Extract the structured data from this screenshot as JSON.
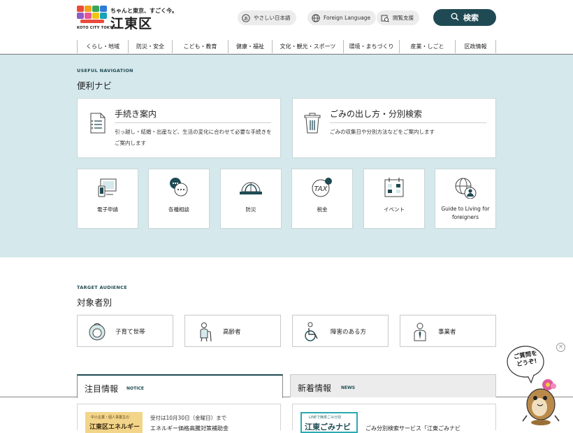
{
  "header": {
    "logo_tagline": "KOTO CITY TOKYO",
    "logo_sub": "ちゃんと東京、すごく今。",
    "logo_main": "江東区",
    "easy_japanese": "やさしい日本語",
    "foreign_language": "Foreign Language",
    "reading_support": "閲覧支援",
    "search": "検索",
    "nav": [
      "くらし・地域",
      "防災・安全",
      "こども・教育",
      "健康・福祉",
      "文化・観光・スポーツ",
      "環境・まちづくり",
      "産業・しごと",
      "区政情報"
    ]
  },
  "useful": {
    "en": "USEFUL NAVIGATION",
    "title": "便利ナビ",
    "big_cards": [
      {
        "title": "手続き案内",
        "desc": "引っ越し・結婚・出産など、生活の変化に合わせて必要な手続きをご案内します"
      },
      {
        "title": "ごみの出し方・分別検索",
        "desc": "ごみの収集日や分別方法などをご案内します"
      }
    ],
    "small_cards": [
      {
        "label": "電子申請",
        "icon": "device-icon"
      },
      {
        "label": "各種相談",
        "icon": "consult-icon"
      },
      {
        "label": "防災",
        "icon": "helmet-icon"
      },
      {
        "label": "税金",
        "icon": "tax-icon"
      },
      {
        "label": "イベント",
        "icon": "calendar-icon"
      },
      {
        "label": "Guide to Living for foreigners",
        "icon": "globe-person-icon"
      }
    ]
  },
  "audience": {
    "en": "TARGET AUDIENCE",
    "title": "対象者別",
    "items": [
      {
        "label": "子育て世帯",
        "icon": "baby-icon"
      },
      {
        "label": "高齢者",
        "icon": "elderly-icon"
      },
      {
        "label": "障害のある方",
        "icon": "wheelchair-icon"
      },
      {
        "label": "事業者",
        "icon": "business-icon"
      }
    ]
  },
  "tabs": [
    {
      "jp": "注目情報",
      "en": "NOTICE"
    },
    {
      "jp": "新着情報",
      "en": "NEWS"
    }
  ],
  "notice": {
    "thumb_small": "中小企業・個人事業主の",
    "thumb_title": "江東区エネルギー",
    "date": "受付は10月30日（金曜日）まで",
    "title": "エネルギー価格高騰対策補助金"
  },
  "news": {
    "thumb_small": "LINEで簡単ごみ分別",
    "thumb_title": "江東ごみナビ",
    "title": "ごみ分別検索サービス「江東ごみナビ"
  },
  "chat": {
    "bubble": "ご質問をどうぞ!"
  },
  "colors": {
    "accent": "#1f4a54",
    "band": "#d5e8ec"
  }
}
